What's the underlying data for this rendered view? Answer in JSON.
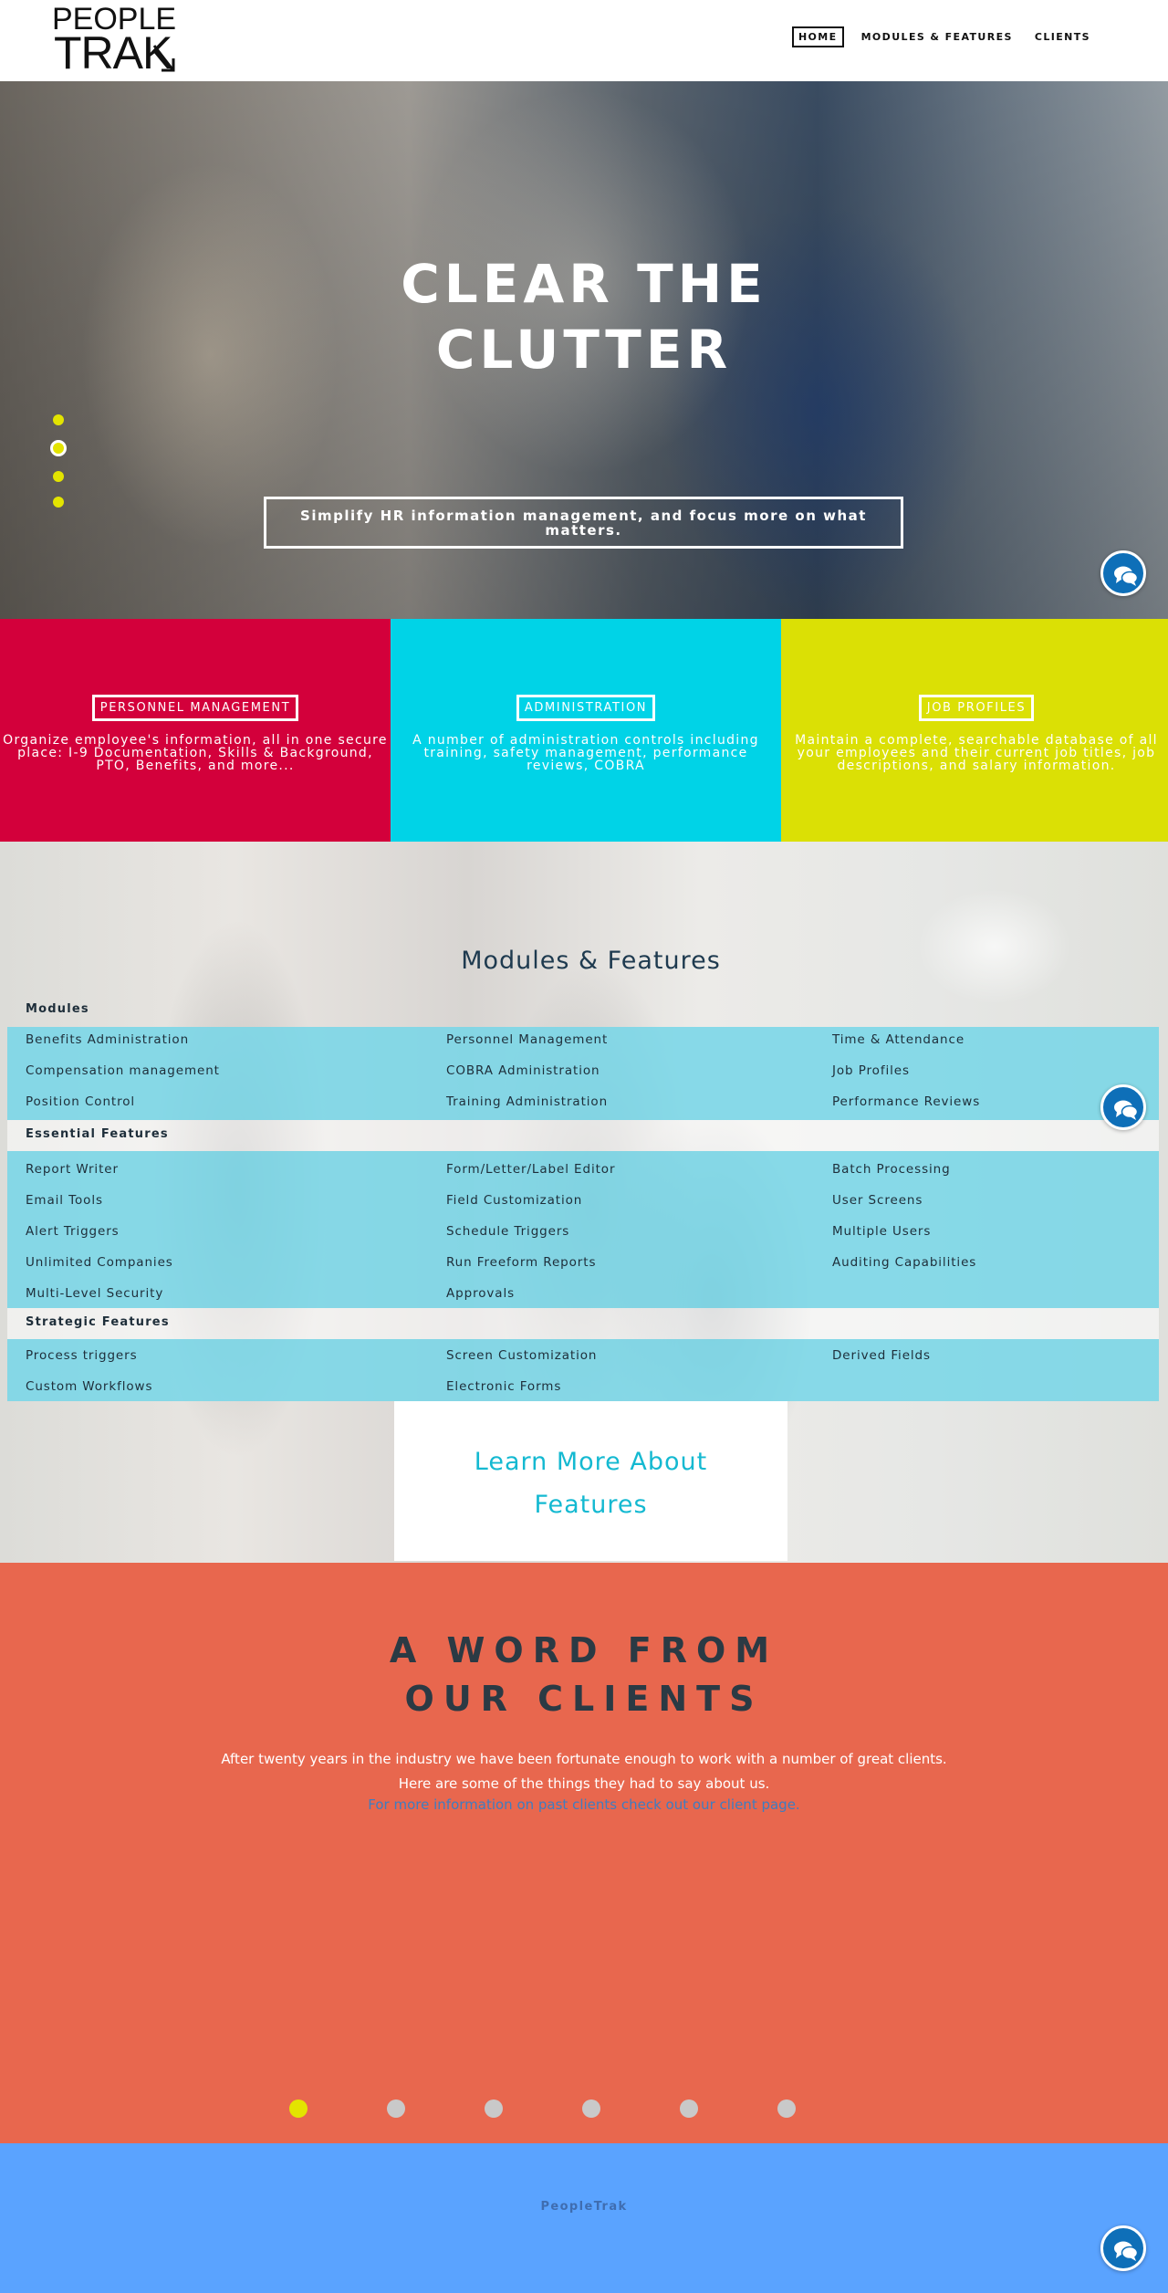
{
  "header": {
    "logo_line1": "PEOPLE",
    "logo_line2": "TRAK",
    "nav": [
      "HOME",
      "MODULES & FEATURES",
      "CLIENTS"
    ]
  },
  "hero": {
    "title_line1": "CLEAR THE",
    "title_line2": "CLUTTER",
    "subtitle": "Simplify HR information management, and focus more on what matters.",
    "slider_dots": 4,
    "active_dot": 1,
    "accent_color": "#e3e400"
  },
  "cards": [
    {
      "title": "PERSONNEL MANAGEMENT",
      "desc": "Organize employee's information, all in one secure place: I-9 Documentation, Skills & Background, PTO, Benefits, and more...",
      "color": "#d3003b"
    },
    {
      "title": "ADMINISTRATION",
      "desc": "A number of administration controls including training, safety management, performance reviews, COBRA",
      "color": "#00d3e7"
    },
    {
      "title": "JOB PROFILES",
      "desc": "Maintain a complete, searchable database of all your employees and their current job titles, job descriptions, and salary information.",
      "color": "#dbe005"
    }
  ],
  "modules": {
    "heading": "Modules & Features",
    "groups": [
      {
        "label": "Modules",
        "rows": [
          [
            "Benefits Administration",
            "Personnel Management",
            "Time & Attendance"
          ],
          [
            "Compensation management",
            "COBRA Administration",
            "Job Profiles"
          ],
          [
            "Position Control",
            "Training Administration",
            "Performance Reviews"
          ]
        ]
      },
      {
        "label": "Essential Features",
        "rows": [
          [
            "Report Writer",
            "Form/Letter/Label Editor",
            "Batch Processing"
          ],
          [
            "Email Tools",
            "Field Customization",
            "User Screens"
          ],
          [
            "Alert Triggers",
            "Schedule Triggers",
            "Multiple Users"
          ],
          [
            "Unlimited Companies",
            "Run Freeform Reports",
            "Auditing Capabilities"
          ],
          [
            "Multi-Level Security",
            "Approvals",
            ""
          ]
        ]
      },
      {
        "label": "Strategic Features",
        "rows": [
          [
            "Process triggers",
            "Screen Customization",
            "Derived Fields"
          ],
          [
            "Custom Workflows",
            "Electronic Forms",
            ""
          ]
        ]
      }
    ],
    "learn_more_line1": "Learn More About",
    "learn_more_line2": "Features"
  },
  "clients": {
    "title_line1": "A WORD FROM",
    "title_line2": "OUR CLIENTS",
    "text_line1": "After twenty years in the industry we have been fortunate enough to work with a number of great clients.",
    "text_line2": "Here are some of the things they had to say about us.",
    "link": "For more information on past clients check out our client page.",
    "slider_dots": 6,
    "active_dot": 0
  },
  "footer": {
    "text": "PeopleTrak"
  },
  "icons": {
    "chat": "chat-bubbles-icon"
  }
}
